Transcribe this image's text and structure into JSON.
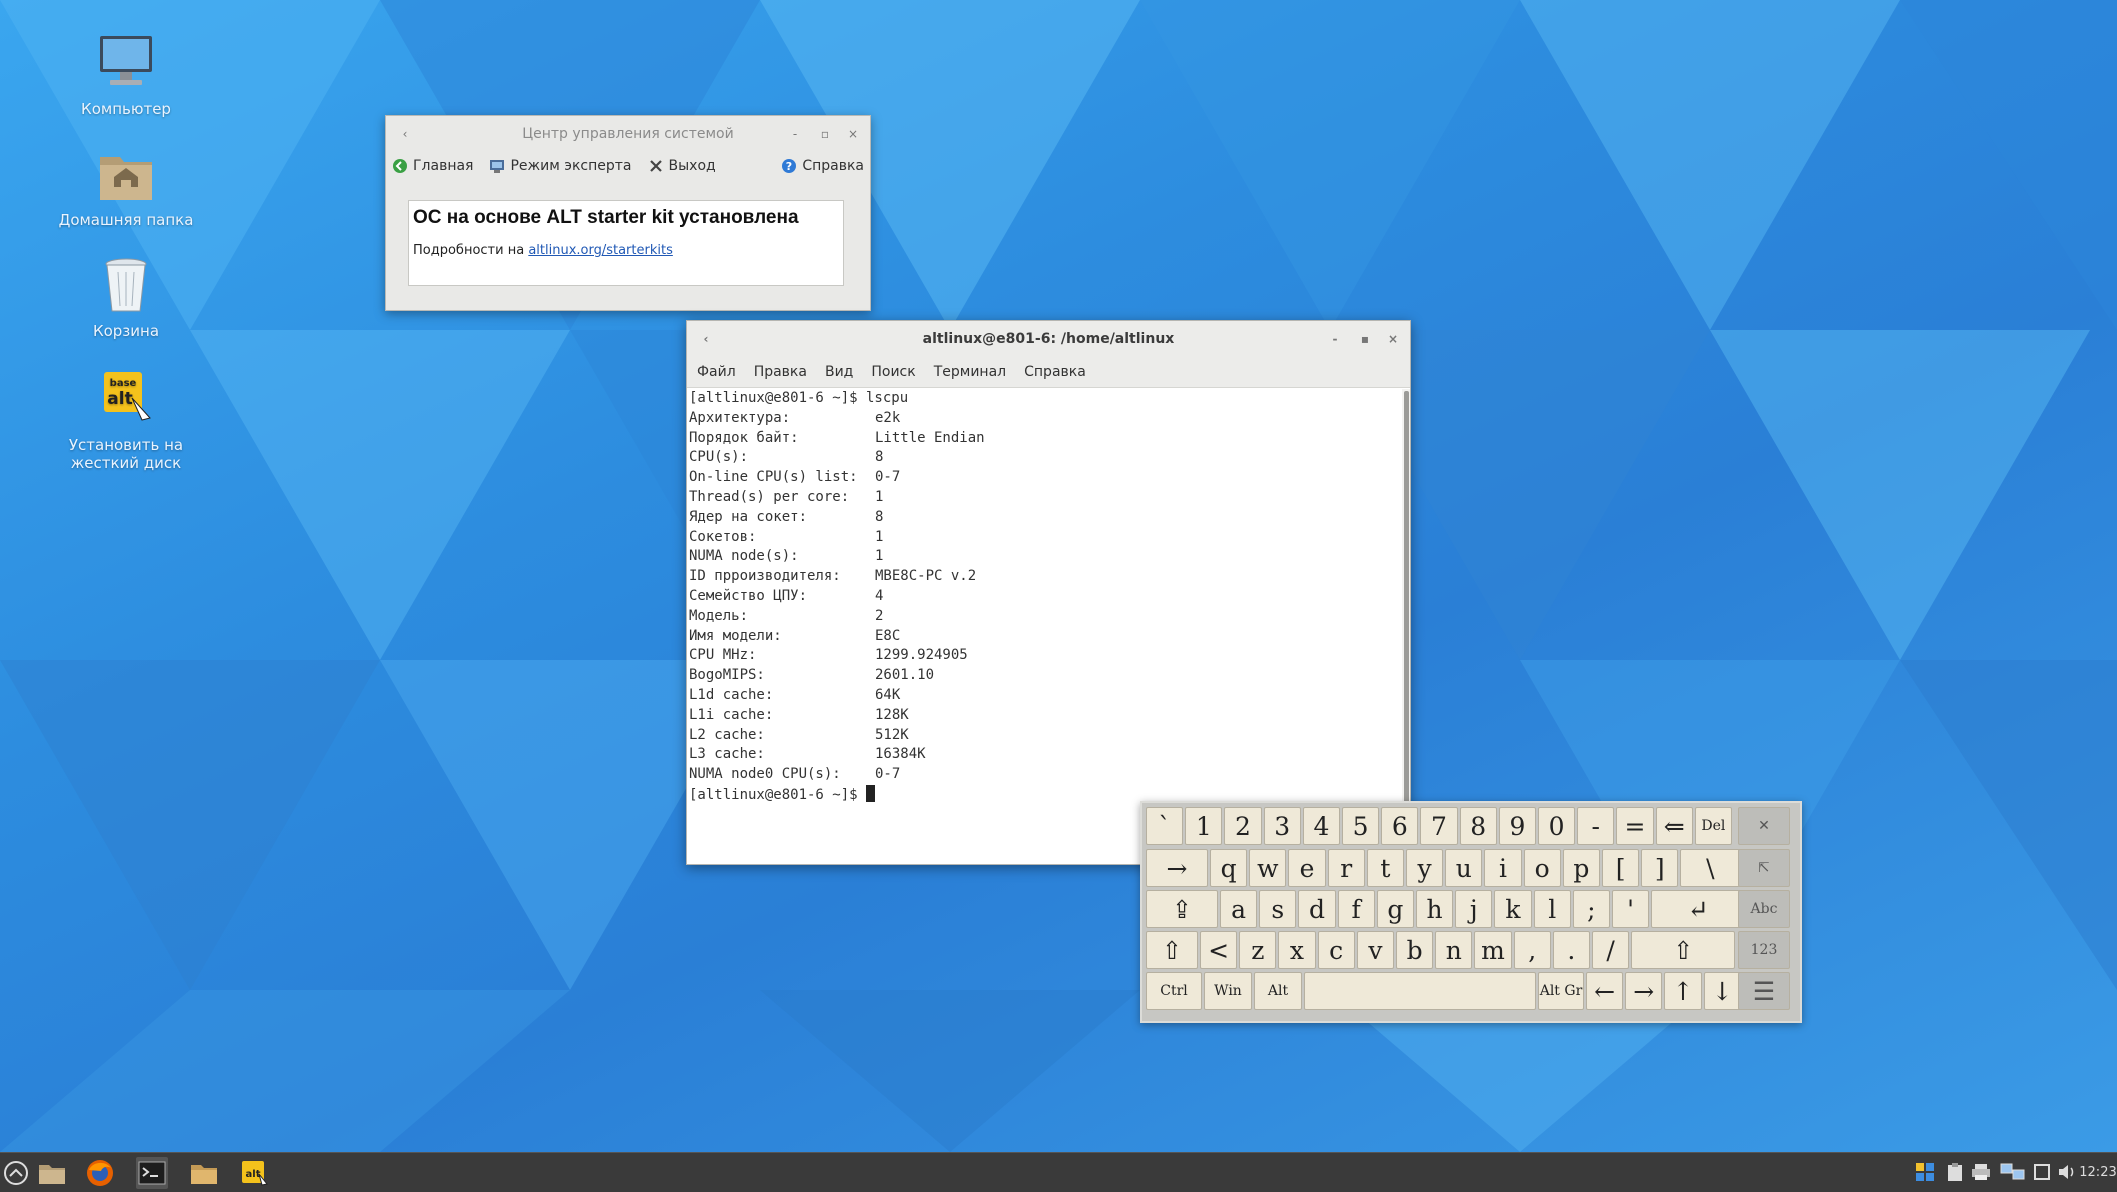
{
  "desktop_icons": [
    {
      "label": "Компьютер",
      "icon": "computer-icon"
    },
    {
      "label": "Домашняя папка",
      "icon": "home-folder-icon"
    },
    {
      "label": "Корзина",
      "icon": "trash-icon"
    },
    {
      "label_line1": "Установить на",
      "label_line2": "жесткий диск",
      "icon": "installer-icon"
    }
  ],
  "control_center": {
    "title": "Центр управления системой",
    "toolbar": {
      "home": "Главная",
      "expert": "Режим эксперта",
      "exit": "Выход",
      "help": "Справка"
    },
    "heading": "ОС на основе ALT starter kit установлена",
    "details_prefix": "Подробности на",
    "details_link": "altlinux.org/starterkits"
  },
  "terminal": {
    "title": "altlinux@e801-6: /home/altlinux",
    "menu": [
      "Файл",
      "Правка",
      "Вид",
      "Поиск",
      "Терминал",
      "Справка"
    ],
    "command_line": "[altlinux@e801-6 ~]$ lscpu",
    "rows": [
      {
        "k": "Архитектура:",
        "v": "e2k"
      },
      {
        "k": "Порядок байт:",
        "v": "Little Endian"
      },
      {
        "k": "CPU(s):",
        "v": "8"
      },
      {
        "k": "On-line CPU(s) list:",
        "v": "0-7"
      },
      {
        "k": "Thread(s) per core:",
        "v": "1"
      },
      {
        "k": "Ядер на сокет:",
        "v": "8"
      },
      {
        "k": "Сокетов:",
        "v": "1"
      },
      {
        "k": "NUMA node(s):",
        "v": "1"
      },
      {
        "k": "ID прроизводителя:",
        "v": "MBE8C-PC v.2"
      },
      {
        "k": "Семейство ЦПУ:",
        "v": "4"
      },
      {
        "k": "Модель:",
        "v": "2"
      },
      {
        "k": "Имя модели:",
        "v": "E8C"
      },
      {
        "k": "CPU MHz:",
        "v": "1299.924905"
      },
      {
        "k": "BogoMIPS:",
        "v": "2601.10"
      },
      {
        "k": "L1d cache:",
        "v": "64K"
      },
      {
        "k": "L1i cache:",
        "v": "128K"
      },
      {
        "k": "L2 cache:",
        "v": "512K"
      },
      {
        "k": "L3 cache:",
        "v": "16384K"
      },
      {
        "k": "NUMA node0 CPU(s):",
        "v": "0-7"
      }
    ],
    "prompt": "[altlinux@e801-6 ~]$ "
  },
  "keyboard": {
    "row1": [
      "`",
      "1",
      "2",
      "3",
      "4",
      "5",
      "6",
      "7",
      "8",
      "9",
      "0",
      "-",
      "=",
      "⇐",
      "Del"
    ],
    "row2": [
      "→",
      "q",
      "w",
      "e",
      "r",
      "t",
      "y",
      "u",
      "i",
      "o",
      "p",
      "[",
      "]",
      "\\"
    ],
    "row3": [
      "⇪",
      "a",
      "s",
      "d",
      "f",
      "g",
      "h",
      "j",
      "k",
      "l",
      ";",
      "'",
      "↵"
    ],
    "row4": [
      "⇧",
      "<",
      "z",
      "x",
      "c",
      "v",
      "b",
      "n",
      "m",
      ",",
      ".",
      "/",
      "⇧"
    ],
    "row5": [
      "Ctrl",
      "Win",
      "Alt",
      "",
      "Alt Gr",
      "←",
      "→",
      "↑",
      "↓"
    ],
    "side": [
      "✕",
      "⇱",
      "Abc",
      "123",
      "☰"
    ]
  },
  "taskbar": {
    "clock": "12:23"
  }
}
